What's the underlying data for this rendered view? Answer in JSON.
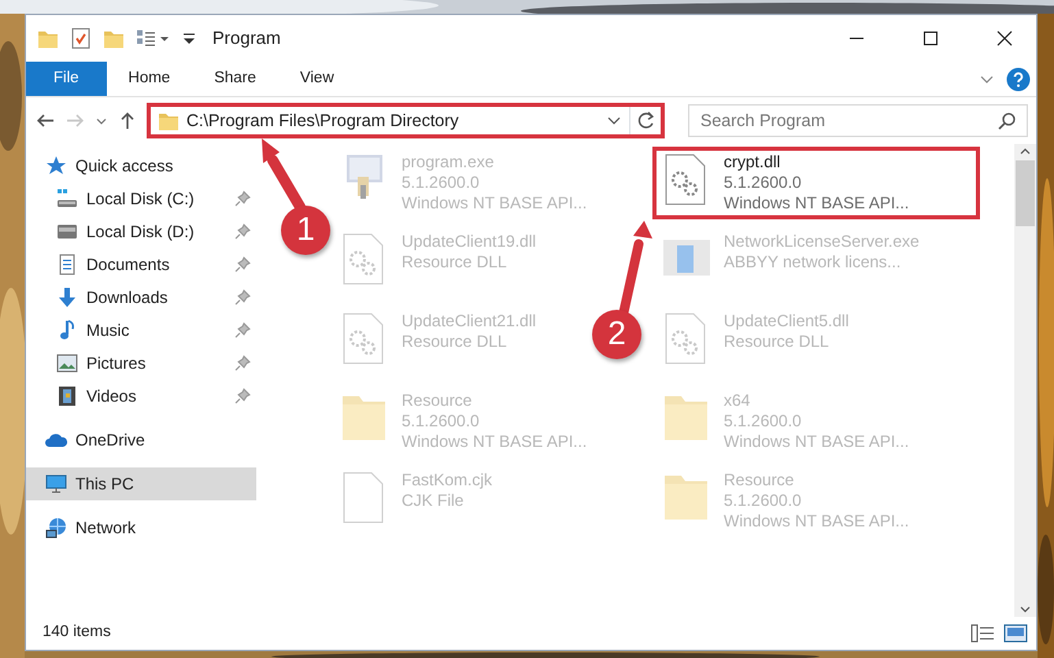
{
  "window": {
    "title": "Program"
  },
  "ribbon": {
    "tabs": [
      {
        "label": "File",
        "kind": "file"
      },
      {
        "label": "Home",
        "kind": "tab"
      },
      {
        "label": "Share",
        "kind": "tab"
      },
      {
        "label": "View",
        "kind": "tab"
      }
    ]
  },
  "address_bar": {
    "path": "C:\\Program Files\\Program Directory",
    "highlighted": true
  },
  "search": {
    "placeholder": "Search Program"
  },
  "sidebar": {
    "items": [
      {
        "label": "Quick access",
        "kind": "quick-access",
        "pinned": false,
        "selected": false,
        "children": [
          {
            "label": "Local Disk (C:)",
            "kind": "drive-c",
            "pinned": true,
            "selected": false
          },
          {
            "label": "Local Disk (D:)",
            "kind": "drive",
            "pinned": true,
            "selected": false
          },
          {
            "label": "Documents",
            "kind": "documents",
            "pinned": true,
            "selected": false
          },
          {
            "label": "Downloads",
            "kind": "downloads",
            "pinned": true,
            "selected": false
          },
          {
            "label": "Music",
            "kind": "music",
            "pinned": true,
            "selected": false
          },
          {
            "label": "Pictures",
            "kind": "pictures",
            "pinned": true,
            "selected": false
          },
          {
            "label": "Videos",
            "kind": "videos",
            "pinned": true,
            "selected": false
          }
        ]
      },
      {
        "label": "OneDrive",
        "kind": "onedrive",
        "pinned": false,
        "selected": false
      },
      {
        "label": "This PC",
        "kind": "pc",
        "pinned": false,
        "selected": true
      },
      {
        "label": "Network",
        "kind": "network",
        "pinned": false,
        "selected": false
      }
    ]
  },
  "files": [
    {
      "name": "program.exe",
      "details": [
        "5.1.2600.0",
        "Windows NT BASE API..."
      ],
      "kind": "exe",
      "blurred": true,
      "highlighted": false
    },
    {
      "name": "crypt.dll",
      "details": [
        "5.1.2600.0",
        "Windows NT BASE API..."
      ],
      "kind": "dll",
      "blurred": false,
      "highlighted": true
    },
    {
      "name": "UpdateClient19.dll",
      "details": [
        "Resource DLL"
      ],
      "kind": "dll",
      "blurred": true,
      "highlighted": false
    },
    {
      "name": "NetworkLicenseServer.exe",
      "details": [
        "ABBYY network licens..."
      ],
      "kind": "app",
      "blurred": true,
      "highlighted": false
    },
    {
      "name": "UpdateClient21.dll",
      "details": [
        "Resource DLL"
      ],
      "kind": "dll",
      "blurred": true,
      "highlighted": false
    },
    {
      "name": "UpdateClient5.dll",
      "details": [
        "Resource DLL"
      ],
      "kind": "dll",
      "blurred": true,
      "highlighted": false
    },
    {
      "name": "Resource",
      "details": [
        "5.1.2600.0",
        "Windows NT BASE API..."
      ],
      "kind": "folder",
      "blurred": true,
      "highlighted": false
    },
    {
      "name": "x64",
      "details": [
        "5.1.2600.0",
        "Windows NT BASE API..."
      ],
      "kind": "folder",
      "blurred": true,
      "highlighted": false
    },
    {
      "name": "FastKom.cjk",
      "details": [
        "CJK File"
      ],
      "kind": "file",
      "blurred": true,
      "highlighted": false
    },
    {
      "name": "Resource",
      "details": [
        "5.1.2600.0",
        "Windows NT BASE API..."
      ],
      "kind": "folder",
      "blurred": true,
      "highlighted": false
    }
  ],
  "status_bar": {
    "count": "140 items"
  },
  "annotations": [
    {
      "label": "1"
    },
    {
      "label": "2"
    }
  ]
}
